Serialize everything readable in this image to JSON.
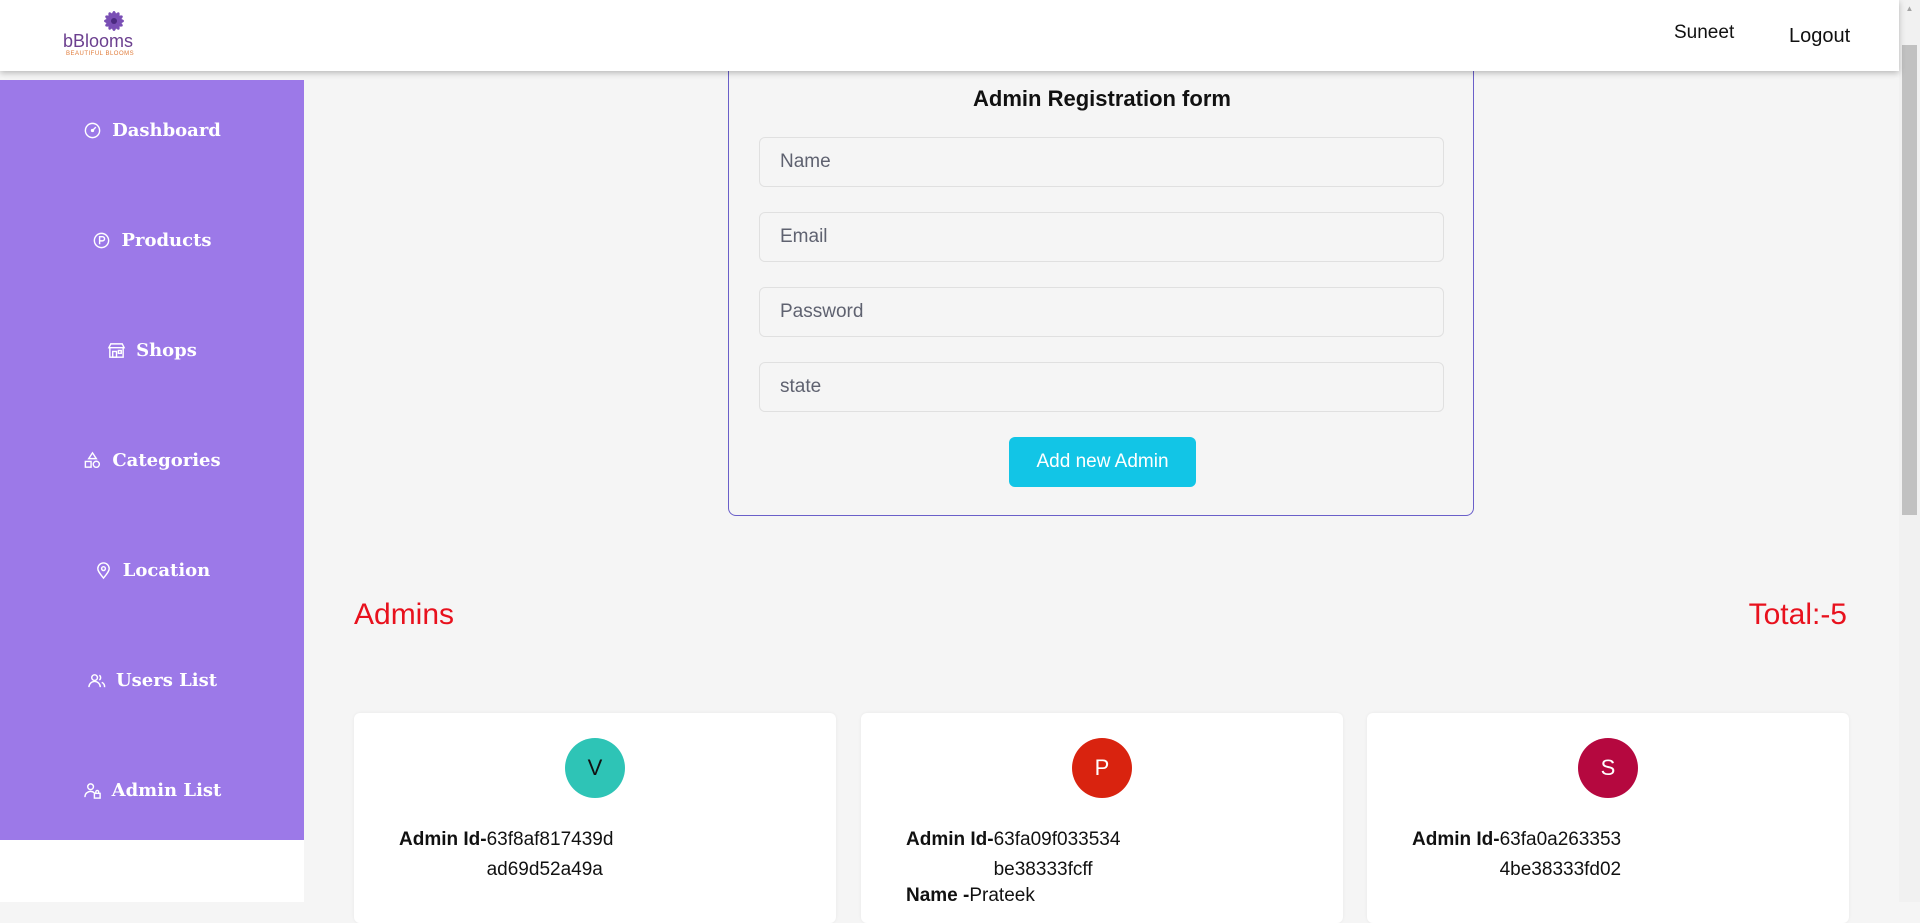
{
  "header": {
    "brand": "bBlooms",
    "tagline": "BEAUTIFUL BLOOMS",
    "user_name": "Suneet",
    "logout_label": "Logout"
  },
  "sidebar": {
    "items": [
      {
        "label": "Dashboard",
        "icon": "dashboard-icon"
      },
      {
        "label": "Products",
        "icon": "product-icon"
      },
      {
        "label": "Shops",
        "icon": "shop-icon"
      },
      {
        "label": "Categories",
        "icon": "categories-icon"
      },
      {
        "label": "Location",
        "icon": "location-icon"
      },
      {
        "label": "Users List",
        "icon": "users-icon"
      },
      {
        "label": "Admin List",
        "icon": "admin-icon"
      }
    ]
  },
  "form": {
    "title": "Admin Registration form",
    "name_placeholder": "Name",
    "email_placeholder": "Email",
    "password_placeholder": "Password",
    "state_placeholder": "state",
    "submit_label": "Add new Admin"
  },
  "admins": {
    "title": "Admins",
    "total": "Total:-5",
    "cards": [
      {
        "initial": "V",
        "color": "#2ec4b6",
        "id_label": "Admin Id-",
        "id": "63f8af817439dad69d52a49a",
        "name_label": "",
        "name": ""
      },
      {
        "initial": "P",
        "color": "#d9230f",
        "id_label": "Admin Id-",
        "id": "63fa09f033534be38333fcff",
        "name_label": "Name -",
        "name": "Prateek"
      },
      {
        "initial": "S",
        "color": "#b5083f",
        "id_label": "Admin Id-",
        "id": "63fa0a2633534be38333fd02",
        "name_label": "",
        "name": ""
      }
    ]
  },
  "colors": {
    "sidebar": "#9c79e8",
    "accent_button": "#12c5e6",
    "heading_red": "#e8111d",
    "form_border": "#6a5fc9"
  }
}
